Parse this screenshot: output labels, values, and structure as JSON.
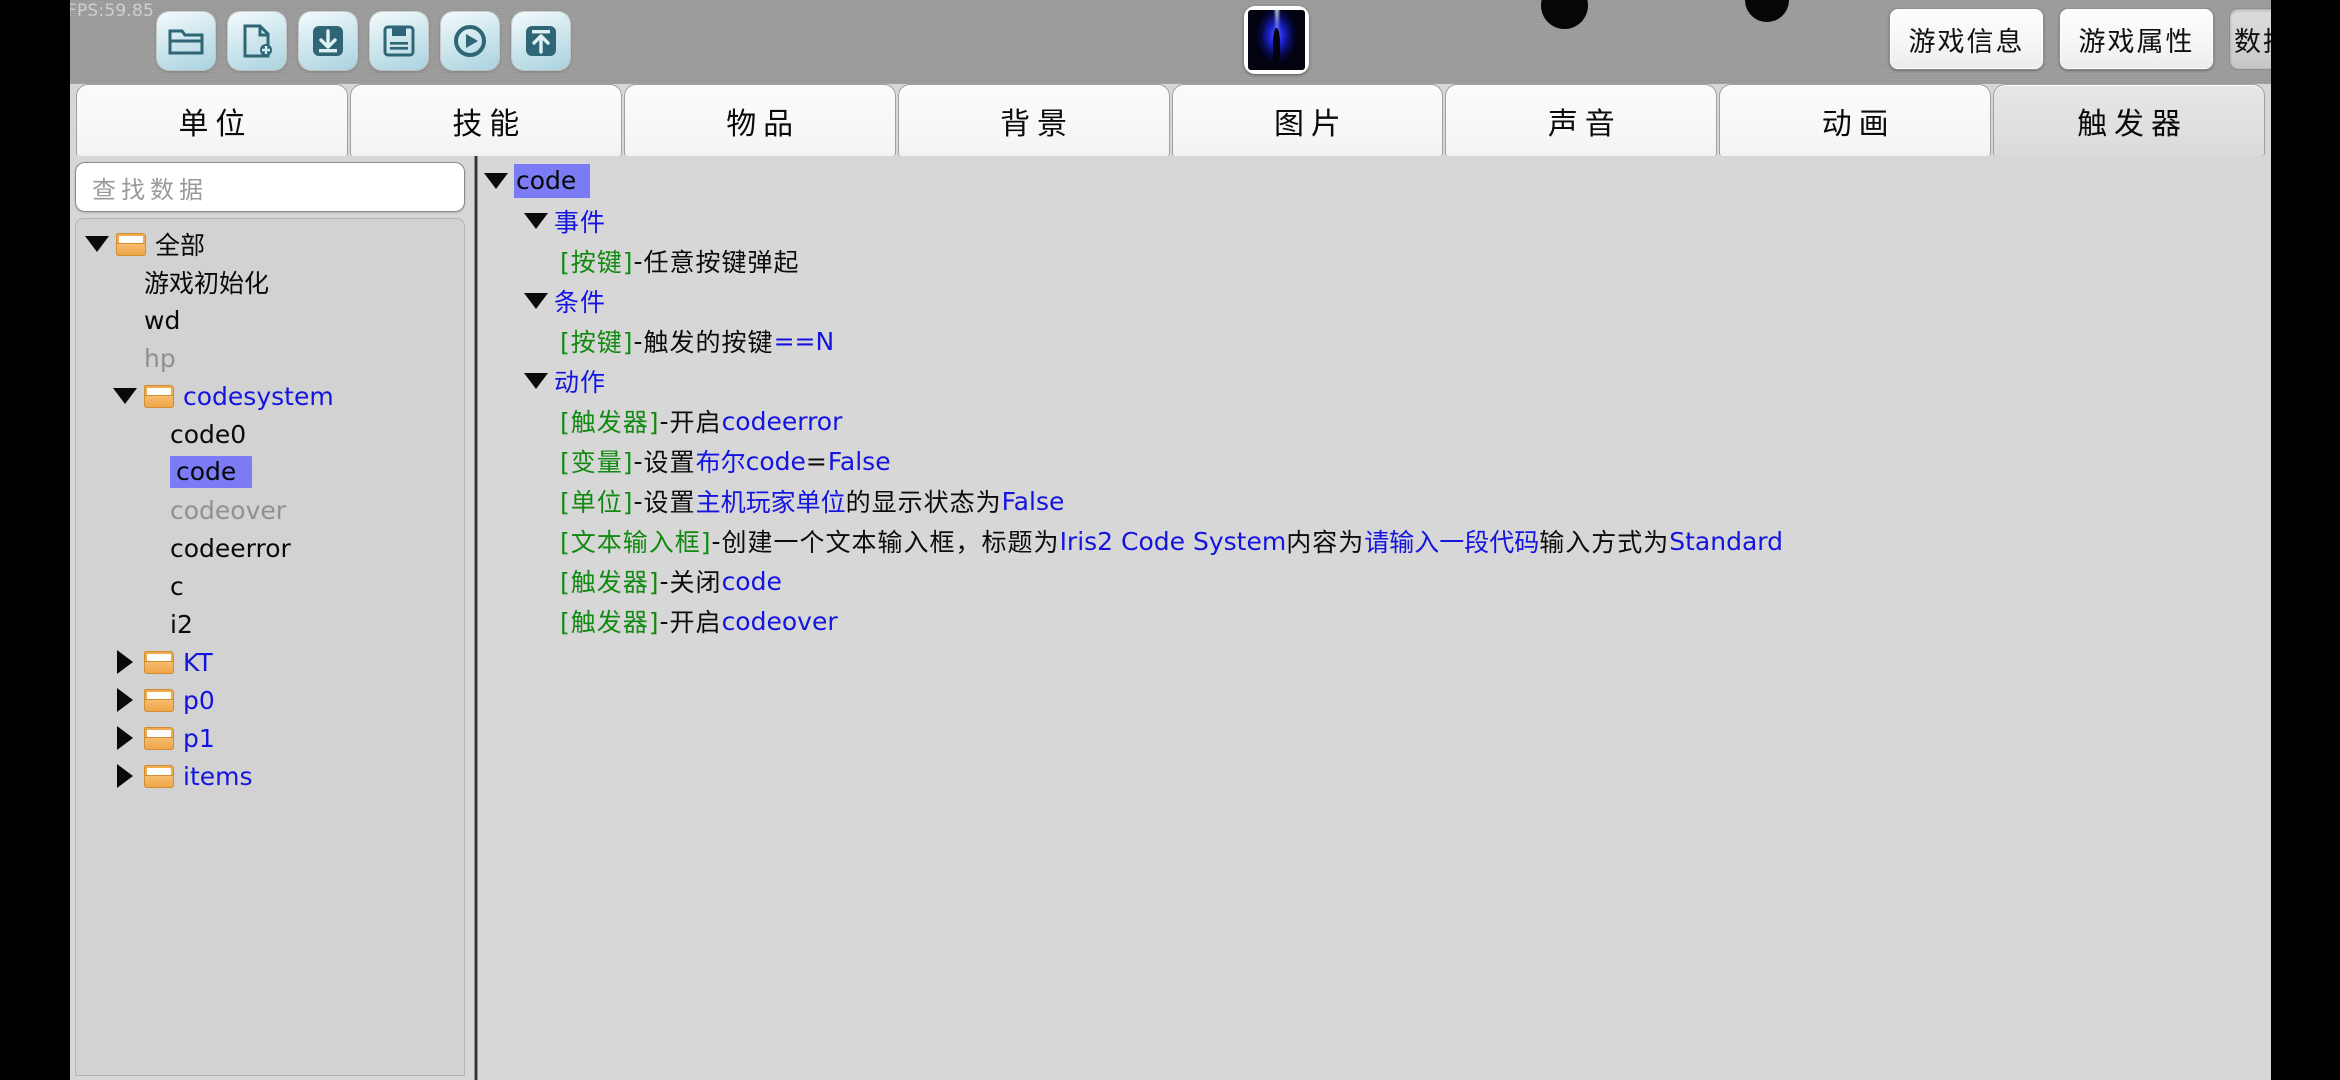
{
  "overlay": {
    "fps": "FPS:59.85"
  },
  "toolbar": {
    "buttons": [
      {
        "name": "open-project",
        "icon": "folder-icon"
      },
      {
        "name": "new-project",
        "icon": "new-file-icon"
      },
      {
        "name": "import",
        "icon": "download-icon"
      },
      {
        "name": "save-project",
        "icon": "save-icon"
      },
      {
        "name": "run-game",
        "icon": "play-icon"
      },
      {
        "name": "export",
        "icon": "upload-icon"
      }
    ]
  },
  "header": {
    "thumbnail_name": "game-thumbnail",
    "buttons": [
      {
        "label": "游戏信息",
        "active": false
      },
      {
        "label": "游戏属性",
        "active": false
      },
      {
        "label": "数据编辑器",
        "active": true
      }
    ]
  },
  "tabs": [
    {
      "label": "单位",
      "active": false
    },
    {
      "label": "技能",
      "active": false
    },
    {
      "label": "物品",
      "active": false
    },
    {
      "label": "背景",
      "active": false
    },
    {
      "label": "图片",
      "active": false
    },
    {
      "label": "声音",
      "active": false
    },
    {
      "label": "动画",
      "active": false
    },
    {
      "label": "触发器",
      "active": true
    }
  ],
  "sidebar": {
    "search": {
      "placeholder": "查找数据",
      "value": ""
    },
    "tree": [
      {
        "label": "全部",
        "indent": 0,
        "twist": "down",
        "folder": true,
        "style": "black",
        "selected": false
      },
      {
        "label": "游戏初始化",
        "indent": 1,
        "twist": "none",
        "folder": false,
        "style": "black",
        "selected": false
      },
      {
        "label": "wd",
        "indent": 1,
        "twist": "none",
        "folder": false,
        "style": "black",
        "selected": false
      },
      {
        "label": "hp",
        "indent": 1,
        "twist": "none",
        "folder": false,
        "style": "gray",
        "selected": false
      },
      {
        "label": "codesystem",
        "indent": 1,
        "twist": "down",
        "folder": true,
        "style": "blue",
        "selected": false
      },
      {
        "label": "code0",
        "indent": 2,
        "twist": "none",
        "folder": false,
        "style": "black",
        "selected": false
      },
      {
        "label": "code",
        "indent": 2,
        "twist": "none",
        "folder": false,
        "style": "black",
        "selected": true
      },
      {
        "label": "codeover",
        "indent": 2,
        "twist": "none",
        "folder": false,
        "style": "gray",
        "selected": false
      },
      {
        "label": "codeerror",
        "indent": 2,
        "twist": "none",
        "folder": false,
        "style": "black",
        "selected": false
      },
      {
        "label": "c",
        "indent": 2,
        "twist": "none",
        "folder": false,
        "style": "black",
        "selected": false
      },
      {
        "label": "i2",
        "indent": 2,
        "twist": "none",
        "folder": false,
        "style": "black",
        "selected": false
      },
      {
        "label": "KT",
        "indent": 1,
        "twist": "right",
        "folder": true,
        "style": "blue",
        "selected": false
      },
      {
        "label": "p0",
        "indent": 1,
        "twist": "right",
        "folder": true,
        "style": "blue",
        "selected": false
      },
      {
        "label": "p1",
        "indent": 1,
        "twist": "right",
        "folder": true,
        "style": "blue",
        "selected": false
      },
      {
        "label": "items",
        "indent": 1,
        "twist": "right",
        "folder": true,
        "style": "blue",
        "selected": false
      }
    ]
  },
  "trigger": {
    "title": "code",
    "sections": [
      {
        "name": "事件",
        "rows": [
          {
            "segments": [
              {
                "text": "[按键]",
                "style": "tag"
              },
              {
                "text": " - ",
                "style": "plain"
              },
              {
                "text": "任意按键弹起",
                "style": "plain"
              }
            ]
          }
        ]
      },
      {
        "name": "条件",
        "rows": [
          {
            "segments": [
              {
                "text": "[按键]",
                "style": "tag"
              },
              {
                "text": " - ",
                "style": "plain"
              },
              {
                "text": "触发的按键",
                "style": "plain"
              },
              {
                "text": " == ",
                "style": "val"
              },
              {
                "text": " N",
                "style": "val"
              }
            ]
          }
        ]
      },
      {
        "name": "动作",
        "rows": [
          {
            "segments": [
              {
                "text": "[触发器]",
                "style": "tag"
              },
              {
                "text": " - ",
                "style": "plain"
              },
              {
                "text": "开启 ",
                "style": "plain"
              },
              {
                "text": "codeerror",
                "style": "val"
              }
            ]
          },
          {
            "segments": [
              {
                "text": "[变量]",
                "style": "tag"
              },
              {
                "text": " - ",
                "style": "plain"
              },
              {
                "text": "设置 ",
                "style": "plain"
              },
              {
                "text": "布尔",
                "style": "val"
              },
              {
                "text": " ",
                "style": "plain"
              },
              {
                "text": "code",
                "style": "val"
              },
              {
                "text": " = ",
                "style": "plain"
              },
              {
                "text": "False",
                "style": "val"
              }
            ]
          },
          {
            "segments": [
              {
                "text": "[单位]",
                "style": "tag"
              },
              {
                "text": " - ",
                "style": "plain"
              },
              {
                "text": "设置 ",
                "style": "plain"
              },
              {
                "text": "主机玩家单位",
                "style": "val"
              },
              {
                "text": " 的显示状态为 ",
                "style": "plain"
              },
              {
                "text": "False",
                "style": "val"
              }
            ]
          },
          {
            "segments": [
              {
                "text": "[文本输入框]",
                "style": "tag"
              },
              {
                "text": " - ",
                "style": "plain"
              },
              {
                "text": "创建一个文本输入框，标题为 ",
                "style": "plain"
              },
              {
                "text": "Iris2 Code System",
                "style": "val"
              },
              {
                "text": " 内容为 ",
                "style": "plain"
              },
              {
                "text": "请输入一段代码",
                "style": "val"
              },
              {
                "text": " 输入方式为 ",
                "style": "plain"
              },
              {
                "text": "Standard",
                "style": "val"
              }
            ]
          },
          {
            "segments": [
              {
                "text": "[触发器]",
                "style": "tag"
              },
              {
                "text": " - ",
                "style": "plain"
              },
              {
                "text": "关闭 ",
                "style": "plain"
              },
              {
                "text": "code",
                "style": "val"
              }
            ]
          },
          {
            "segments": [
              {
                "text": "[触发器]",
                "style": "tag"
              },
              {
                "text": " - ",
                "style": "plain"
              },
              {
                "text": "开启 ",
                "style": "plain"
              },
              {
                "text": "codeover",
                "style": "val"
              }
            ]
          }
        ]
      }
    ]
  }
}
